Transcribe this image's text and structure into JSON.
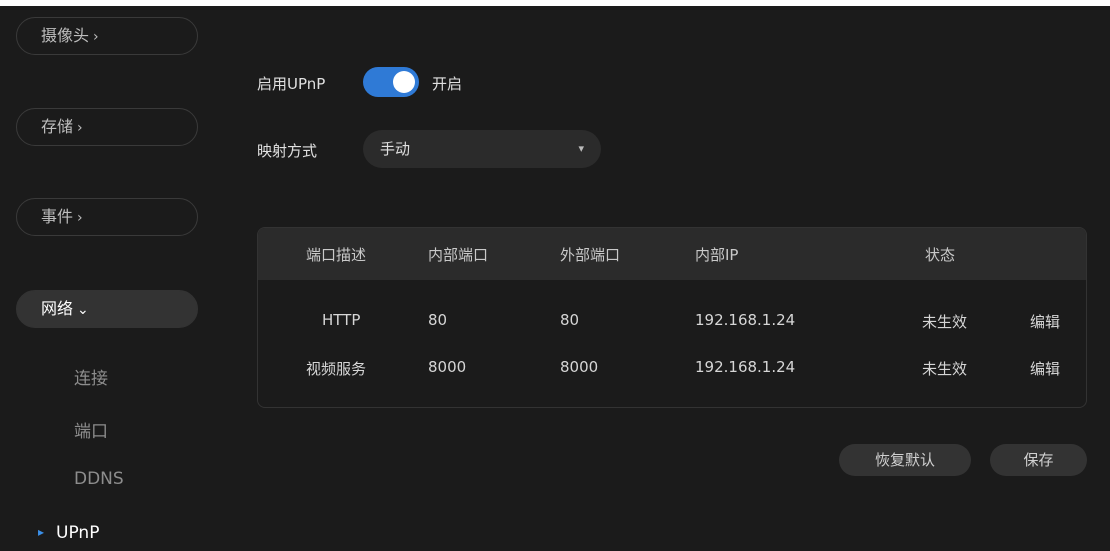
{
  "sidebar": {
    "items": [
      {
        "label": "摄像头",
        "chevron": "›"
      },
      {
        "label": "存储",
        "chevron": "›"
      },
      {
        "label": "事件",
        "chevron": "›"
      },
      {
        "label": "网络",
        "chevron": "⌄"
      }
    ],
    "network_sub": [
      "连接",
      "端口",
      "DDNS",
      "UPnP"
    ],
    "active_sub_marker": "▸"
  },
  "upnp": {
    "enable_label": "启用UPnP",
    "toggle_state": "开启",
    "mapping_label": "映射方式",
    "mapping_value": "手动",
    "caret": "▾"
  },
  "table": {
    "headers": [
      "端口描述",
      "内部端口",
      "外部端口",
      "内部IP",
      "状态"
    ],
    "rows": [
      {
        "desc": "HTTP",
        "internal": "80",
        "external": "80",
        "ip": "192.168.1.24",
        "status": "未生效",
        "action": "编辑"
      },
      {
        "desc": "视频服务",
        "internal": "8000",
        "external": "8000",
        "ip": "192.168.1.24",
        "status": "未生效",
        "action": "编辑"
      }
    ]
  },
  "buttons": {
    "restore": "恢复默认",
    "save": "保存"
  },
  "colors": {
    "background": "#1b1b1b",
    "accent": "#2f7ad6",
    "panel": "#2b2b2b"
  }
}
